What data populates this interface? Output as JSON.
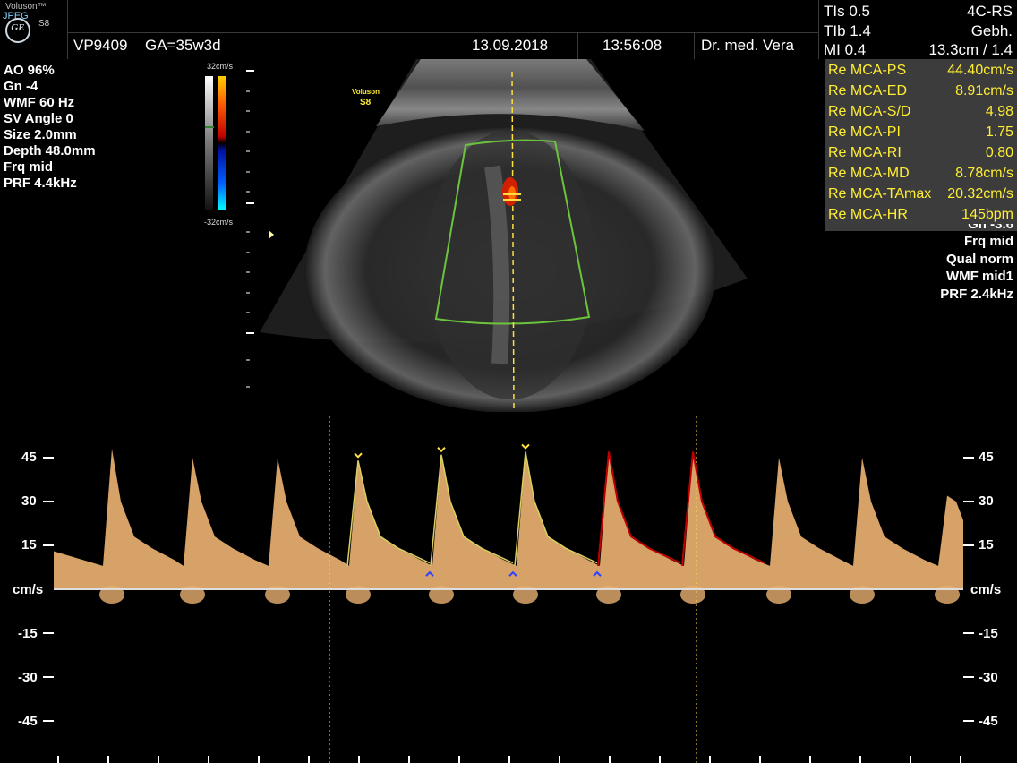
{
  "header": {
    "brand": "Voluson™",
    "jpeg_label": "JPEG",
    "logo_text": "GE",
    "model": "S8",
    "patient_id": "VP9409",
    "gestational_age": "GA=35w3d",
    "date": "13.09.2018",
    "time": "13:56:08",
    "doctor": "Dr. med. Vera"
  },
  "safety": {
    "tis": "TIs  0.5",
    "tib": "TIb  1.4",
    "mi": "MI  0.4"
  },
  "probe": {
    "name": "4C-RS",
    "preset": "Gebh.",
    "depth": "13.3cm / 1.4"
  },
  "left_params": [
    "AO 96%",
    "Gn  -4",
    "WMF 60 Hz",
    "SV Angle  0",
    "Size  2.0mm",
    "Depth 48.0mm",
    "Frq mid",
    "PRF  4.4kHz"
  ],
  "colorbar": {
    "top_label": "32cm/s",
    "bottom_label": "-32cm/s"
  },
  "image_watermark": {
    "brand": "Voluson",
    "model": "S8"
  },
  "measurements": [
    {
      "label": "Re MCA-PS",
      "value": "44.40cm/s"
    },
    {
      "label": "Re MCA-ED",
      "value": "8.91cm/s"
    },
    {
      "label": "Re MCA-S/D",
      "value": "4.98"
    },
    {
      "label": "Re MCA-PI",
      "value": "1.75"
    },
    {
      "label": "Re MCA-RI",
      "value": "0.80"
    },
    {
      "label": "Re MCA-MD",
      "value": "8.78cm/s"
    },
    {
      "label": "Re MCA-TAmax",
      "value": "20.32cm/s"
    },
    {
      "label": "Re MCA-HR",
      "value": "145bpm"
    }
  ],
  "right_color_params": [
    "Gn -3.6",
    "Frq mid",
    "Qual norm",
    "WMF mid1",
    "PRF  2.4kHz"
  ],
  "doppler": {
    "unit_label": "cm/s",
    "ticks": [
      "45",
      "30",
      "15",
      "-15",
      "-30",
      "-45"
    ]
  },
  "colors": {
    "spectrum": "#e8b070",
    "trace_yellow": "#d8d060",
    "trace_red": "#c00000",
    "roi_green": "#6cc43c",
    "meas_text": "#ffee33",
    "panel_bg": "#3c3c3c"
  }
}
